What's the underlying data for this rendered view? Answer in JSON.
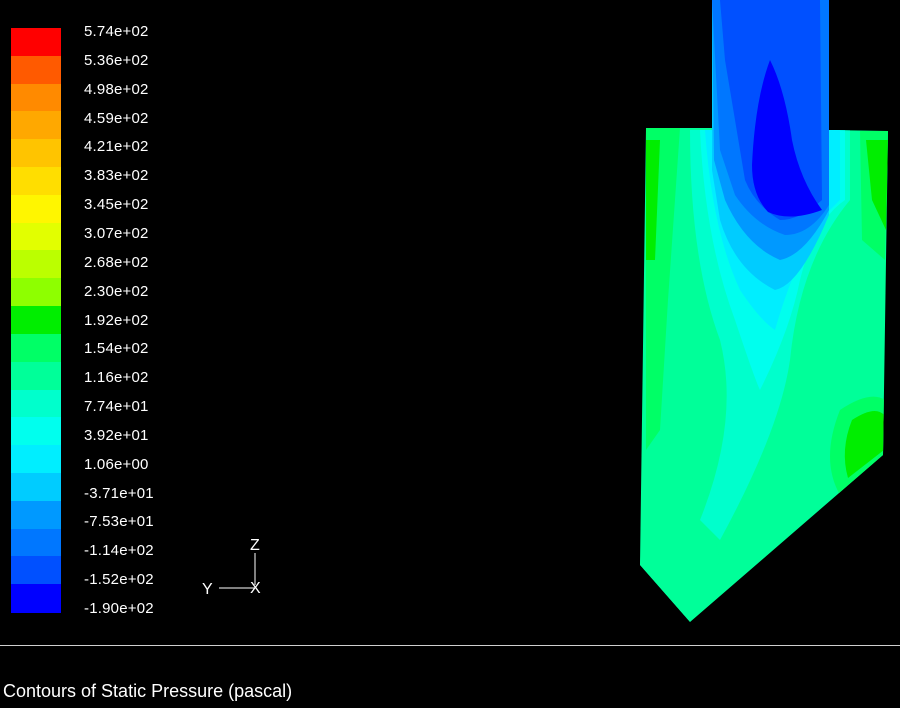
{
  "legend": {
    "labels": [
      "5.74e+02",
      "5.36e+02",
      "4.98e+02",
      "4.59e+02",
      "4.21e+02",
      "3.83e+02",
      "3.45e+02",
      "3.07e+02",
      "2.68e+02",
      "2.30e+02",
      "1.92e+02",
      "1.54e+02",
      "1.16e+02",
      "7.74e+01",
      "3.92e+01",
      "1.06e+00",
      "-3.71e+01",
      "-7.53e+01",
      "-1.14e+02",
      "-1.52e+02",
      "-1.90e+02"
    ],
    "colors": [
      "#ff0000",
      "#ff5a00",
      "#ff8a00",
      "#ffa800",
      "#ffc400",
      "#ffde00",
      "#fff600",
      "#e2ff00",
      "#bbff00",
      "#8eff00",
      "#00ee00",
      "#00ff66",
      "#00ff99",
      "#00ffcc",
      "#00ffee",
      "#00eeff",
      "#00ccff",
      "#0099ff",
      "#0077ff",
      "#0050ff",
      "#0000ff"
    ]
  },
  "axes": {
    "vertical": "Z",
    "horizontal": "Y",
    "out_of_plane": "X"
  },
  "caption": "Contours of Static Pressure (pascal)"
}
